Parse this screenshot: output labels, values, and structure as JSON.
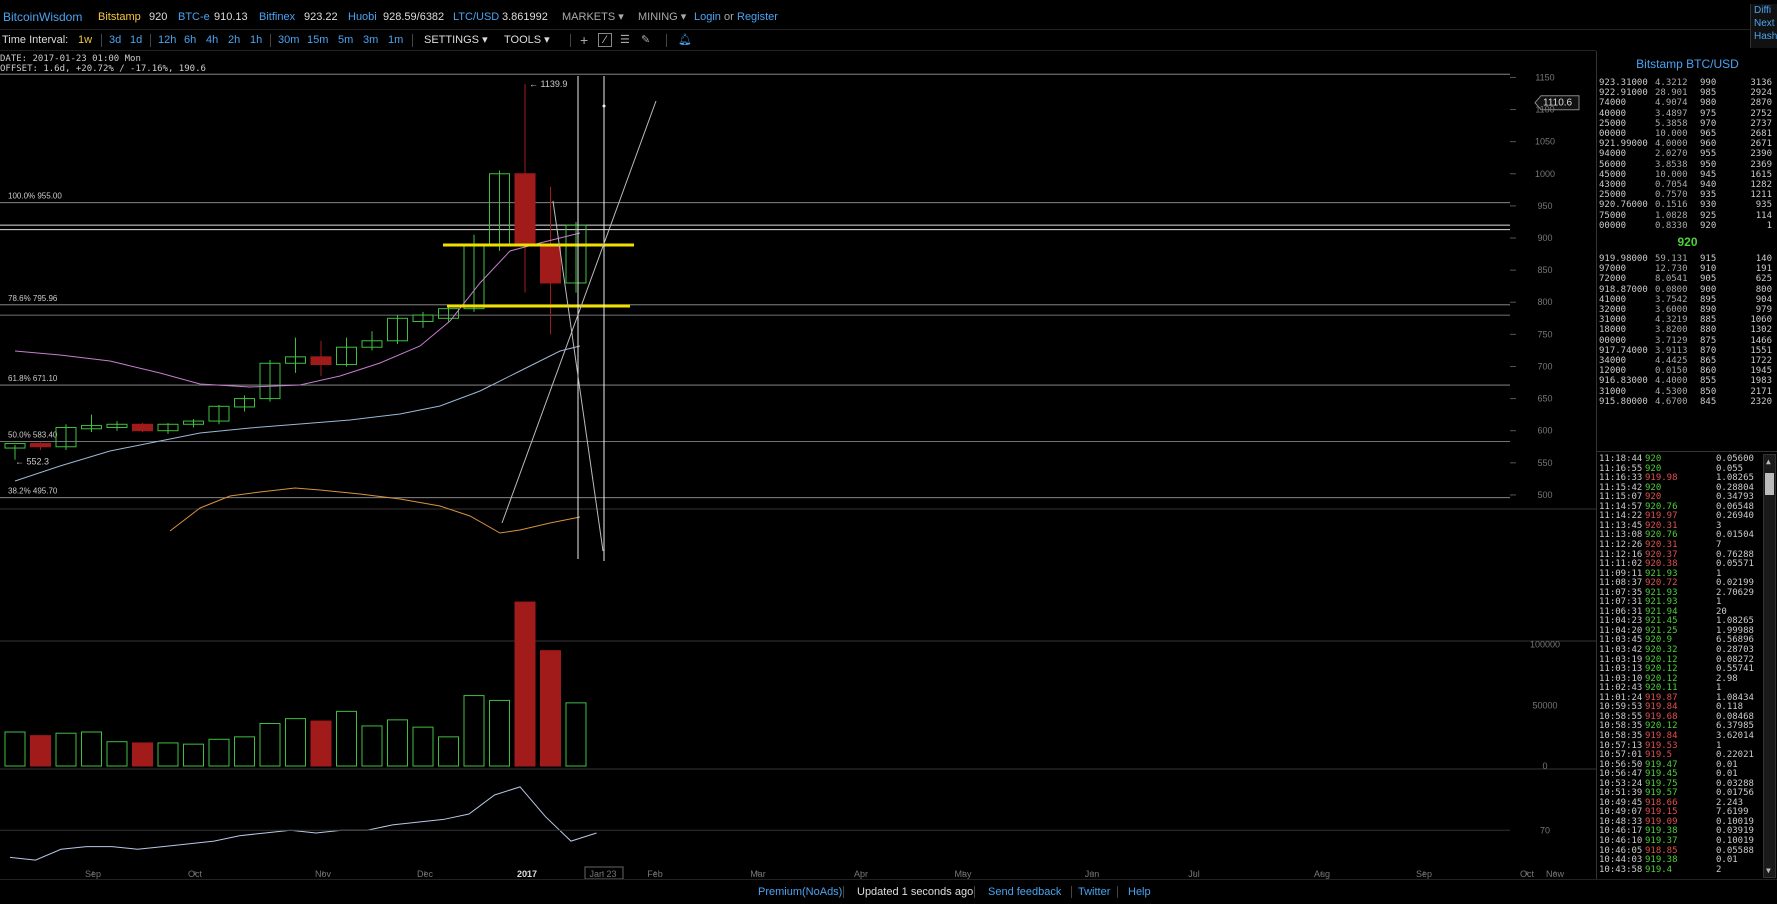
{
  "topbar": {
    "brand": "BitcoinWisdom",
    "exchanges": [
      {
        "name": "Bitstamp",
        "price": "920",
        "active": true
      },
      {
        "name": "BTC-e",
        "price": "910.13"
      },
      {
        "name": "Bitfinex",
        "price": "923.22"
      },
      {
        "name": "Huobi",
        "price": "928.59/6382"
      },
      {
        "name": "LTC/USD",
        "price": "3.861992"
      }
    ],
    "markets_label": "MARKETS",
    "mining_label": "MINING",
    "login_label": "Login",
    "or_label": "or",
    "register_label": "Register",
    "right_links": [
      "Diffi",
      "Next",
      "Hash"
    ]
  },
  "toolbar": {
    "time_interval_label": "Time Interval:",
    "intervals": [
      "1w",
      "3d",
      "1d",
      "12h",
      "6h",
      "4h",
      "2h",
      "1h",
      "30m",
      "15m",
      "5m",
      "3m",
      "1m"
    ],
    "active_interval": "1w",
    "settings_label": "SETTINGS",
    "tools_label": "TOOLS"
  },
  "chart_info": {
    "date_line": "DATE: 2017-01-23 01:00 Mon",
    "offset_line": "OFFSET: 1.6d, +20.72% / -17.16%, 190.6"
  },
  "chart_data": [
    {
      "type": "candlestick",
      "y_ticks": [
        500,
        550,
        600,
        650,
        700,
        750,
        800,
        850,
        900,
        950,
        1000,
        1050,
        1100,
        1150
      ],
      "ylim": [
        475,
        1160
      ],
      "x_ticks": [
        "Sep",
        "Oct",
        "Nov",
        "Dec",
        "2017",
        "Jan 23",
        "Feb",
        "Mar",
        "Apr",
        "May",
        "Jun",
        "Jul",
        "Aug",
        "Sep",
        "Oct",
        "Now"
      ],
      "candles": [
        {
          "o": 573,
          "h": 578,
          "l": 555,
          "c": 580,
          "up": true
        },
        {
          "o": 580,
          "h": 582,
          "l": 570,
          "c": 575,
          "up": false
        },
        {
          "o": 575,
          "h": 610,
          "l": 570,
          "c": 605,
          "up": true
        },
        {
          "o": 603,
          "h": 625,
          "l": 598,
          "c": 608,
          "up": true
        },
        {
          "o": 605,
          "h": 615,
          "l": 600,
          "c": 610,
          "up": true
        },
        {
          "o": 610,
          "h": 612,
          "l": 598,
          "c": 600,
          "up": false
        },
        {
          "o": 600,
          "h": 612,
          "l": 595,
          "c": 610,
          "up": true
        },
        {
          "o": 610,
          "h": 618,
          "l": 605,
          "c": 615,
          "up": true
        },
        {
          "o": 615,
          "h": 640,
          "l": 610,
          "c": 638,
          "up": true
        },
        {
          "o": 637,
          "h": 655,
          "l": 630,
          "c": 650,
          "up": true
        },
        {
          "o": 650,
          "h": 710,
          "l": 645,
          "c": 705,
          "up": true
        },
        {
          "o": 705,
          "h": 745,
          "l": 690,
          "c": 715,
          "up": true
        },
        {
          "o": 715,
          "h": 740,
          "l": 685,
          "c": 703,
          "up": false
        },
        {
          "o": 703,
          "h": 745,
          "l": 700,
          "c": 730,
          "up": true
        },
        {
          "o": 730,
          "h": 755,
          "l": 725,
          "c": 740,
          "up": true
        },
        {
          "o": 740,
          "h": 780,
          "l": 735,
          "c": 775,
          "up": true
        },
        {
          "o": 770,
          "h": 785,
          "l": 760,
          "c": 780,
          "up": true
        },
        {
          "o": 775,
          "h": 795,
          "l": 770,
          "c": 790,
          "up": true
        },
        {
          "o": 790,
          "h": 905,
          "l": 785,
          "c": 890,
          "up": true
        },
        {
          "o": 890,
          "h": 1005,
          "l": 880,
          "c": 1000,
          "up": true
        },
        {
          "o": 1000,
          "h": 1140,
          "l": 815,
          "c": 890,
          "up": false
        },
        {
          "o": 890,
          "h": 980,
          "l": 750,
          "c": 830,
          "up": false
        },
        {
          "o": 830,
          "h": 925,
          "l": 815,
          "c": 920,
          "up": true
        }
      ],
      "annotations": [
        "← 1139.9",
        "← 552.3",
        "1110.6"
      ],
      "fib_levels": [
        {
          "label": "100.0% 955.00",
          "value": 955
        },
        {
          "label": "78.6% 795.96",
          "value": 795.96
        },
        {
          "label": "61.8% 671.10",
          "value": 671.1
        },
        {
          "label": "50.0% 583.40",
          "value": 583.4
        },
        {
          "label": "38.2% 495.70",
          "value": 495.7
        }
      ]
    },
    {
      "type": "bar",
      "name": "volume",
      "y_ticks": [
        0,
        50000,
        100000
      ],
      "values": [
        28000,
        25000,
        27000,
        28000,
        20000,
        19000,
        19000,
        18000,
        22000,
        24000,
        35000,
        39000,
        37000,
        45000,
        33000,
        38000,
        32000,
        24000,
        58000,
        54000,
        135000,
        95000,
        52000
      ],
      "up": [
        true,
        false,
        true,
        true,
        true,
        false,
        true,
        true,
        true,
        true,
        true,
        true,
        false,
        true,
        true,
        true,
        true,
        true,
        true,
        true,
        false,
        false,
        true
      ]
    },
    {
      "type": "line",
      "name": "oscillator",
      "y_ticks": [
        70
      ],
      "values": [
        60,
        59,
        63,
        64,
        64,
        63,
        64,
        65,
        66,
        68,
        69,
        70,
        69,
        70,
        70,
        72,
        73,
        74,
        76,
        83,
        86,
        75,
        66,
        69
      ]
    }
  ],
  "orderbook": {
    "title": "Bitstamp BTC/USD",
    "asks": [
      [
        "923.31000",
        "4.3212",
        "990",
        "3136"
      ],
      [
        "922.91000",
        "28.901",
        "985",
        "2924"
      ],
      [
        "74000",
        "4.9074",
        "980",
        "2870"
      ],
      [
        "40000",
        "3.4897",
        "975",
        "2752"
      ],
      [
        "25000",
        "5.3858",
        "970",
        "2737"
      ],
      [
        "00000",
        "10.000",
        "965",
        "2681"
      ],
      [
        "921.99000",
        "4.0000",
        "960",
        "2671"
      ],
      [
        "94000",
        "2.0270",
        "955",
        "2390"
      ],
      [
        "56000",
        "3.8538",
        "950",
        "2369"
      ],
      [
        "45000",
        "10.000",
        "945",
        "1615"
      ],
      [
        "43000",
        "0.7054",
        "940",
        "1282"
      ],
      [
        "25000",
        "0.7570",
        "935",
        "1211"
      ],
      [
        "920.76000",
        "0.1516",
        "930",
        "935"
      ],
      [
        "75000",
        "1.0828",
        "925",
        "114"
      ],
      [
        "00000",
        "0.8330",
        "920",
        "1"
      ]
    ],
    "mid": "920",
    "bids": [
      [
        "919.98000",
        "59.131",
        "915",
        "140"
      ],
      [
        "97000",
        "12.730",
        "910",
        "191"
      ],
      [
        "72000",
        "8.0541",
        "905",
        "625"
      ],
      [
        "918.87000",
        "0.0800",
        "900",
        "800"
      ],
      [
        "41000",
        "3.7542",
        "895",
        "904"
      ],
      [
        "32000",
        "3.6000",
        "890",
        "979"
      ],
      [
        "31000",
        "4.3219",
        "885",
        "1060"
      ],
      [
        "18000",
        "3.8200",
        "880",
        "1302"
      ],
      [
        "00000",
        "3.7129",
        "875",
        "1466"
      ],
      [
        "917.74000",
        "3.9113",
        "870",
        "1551"
      ],
      [
        "34000",
        "4.4425",
        "865",
        "1722"
      ],
      [
        "12000",
        "0.0150",
        "860",
        "1945"
      ],
      [
        "916.83000",
        "4.4000",
        "855",
        "1983"
      ],
      [
        "31000",
        "4.5300",
        "850",
        "2171"
      ],
      [
        "915.80000",
        "4.6700",
        "845",
        "2320"
      ]
    ]
  },
  "trades": [
    [
      "11:18:44",
      "920",
      "0.05600",
      "g"
    ],
    [
      "11:16:55",
      "920",
      "0.055",
      "g"
    ],
    [
      "11:16:33",
      "919.98",
      "1.08265",
      "r"
    ],
    [
      "11:15:42",
      "920",
      "0.28804",
      "g"
    ],
    [
      "11:15:07",
      "920",
      "0.34793",
      "r"
    ],
    [
      "11:14:57",
      "920.76",
      "0.06548",
      "g"
    ],
    [
      "11:14:22",
      "919.97",
      "0.26940",
      "r"
    ],
    [
      "11:13:45",
      "920.31",
      "3",
      "r"
    ],
    [
      "11:13:08",
      "920.76",
      "0.01504",
      "g"
    ],
    [
      "11:12:26",
      "920.31",
      "7",
      "r"
    ],
    [
      "11:12:16",
      "920.37",
      "0.76288",
      "r"
    ],
    [
      "11:11:02",
      "920.38",
      "0.05571",
      "r"
    ],
    [
      "11:09:11",
      "921.93",
      "1",
      "g"
    ],
    [
      "11:08:37",
      "920.72",
      "0.02199",
      "r"
    ],
    [
      "11:07:35",
      "921.93",
      "2.70629",
      "g"
    ],
    [
      "11:07:31",
      "921.93",
      "1",
      "g"
    ],
    [
      "11:06:31",
      "921.94",
      "20",
      "g"
    ],
    [
      "11:04:23",
      "921.45",
      "1.08265",
      "g"
    ],
    [
      "11:04:20",
      "921.25",
      "1.99988",
      "g"
    ],
    [
      "11:03:45",
      "920.9",
      "6.56896",
      "g"
    ],
    [
      "11:03:42",
      "920.32",
      "0.28703",
      "g"
    ],
    [
      "11:03:19",
      "920.12",
      "0.08272",
      "g"
    ],
    [
      "11:03:13",
      "920.12",
      "0.55741",
      "g"
    ],
    [
      "11:03:10",
      "920.12",
      "2.98",
      "g"
    ],
    [
      "11:02:43",
      "920.11",
      "1",
      "g"
    ],
    [
      "11:01:24",
      "919.87",
      "1.08434",
      "r"
    ],
    [
      "10:59:53",
      "919.84",
      "0.118",
      "r"
    ],
    [
      "10:58:55",
      "919.68",
      "0.08468",
      "r"
    ],
    [
      "10:58:35",
      "920.12",
      "6.37985",
      "g"
    ],
    [
      "10:58:35",
      "919.84",
      "3.62014",
      "r"
    ],
    [
      "10:57:13",
      "919.53",
      "1",
      "r"
    ],
    [
      "10:57:01",
      "919.5",
      "0.22021",
      "r"
    ],
    [
      "10:56:50",
      "919.47",
      "0.01",
      "g"
    ],
    [
      "10:56:47",
      "919.45",
      "0.01",
      "g"
    ],
    [
      "10:53:24",
      "919.75",
      "0.03288",
      "g"
    ],
    [
      "10:51:39",
      "919.57",
      "0.01756",
      "g"
    ],
    [
      "10:49:45",
      "918.66",
      "2.243",
      "r"
    ],
    [
      "10:49:07",
      "919.15",
      "7.6199",
      "r"
    ],
    [
      "10:48:33",
      "919.09",
      "0.10019",
      "r"
    ],
    [
      "10:46:17",
      "919.38",
      "0.03919",
      "g"
    ],
    [
      "10:46:10",
      "919.37",
      "0.10019",
      "g"
    ],
    [
      "10:46:05",
      "918.85",
      "0.05588",
      "r"
    ],
    [
      "10:44:03",
      "919.38",
      "0.01",
      "g"
    ],
    [
      "10:43:58",
      "919.4",
      "2",
      "g"
    ]
  ],
  "statusbar": {
    "premium": "Premium(NoAds)",
    "updated": "Updated 1 seconds ago",
    "feedback": "Send feedback",
    "twitter": "Twitter",
    "help": "Help"
  },
  "colors": {
    "up": "#3fbf3f",
    "down": "#a11b1b",
    "accent": "#4aa3f0",
    "fib": "#e5e500",
    "ask": "#cccccc",
    "bid": "#cccccc"
  }
}
